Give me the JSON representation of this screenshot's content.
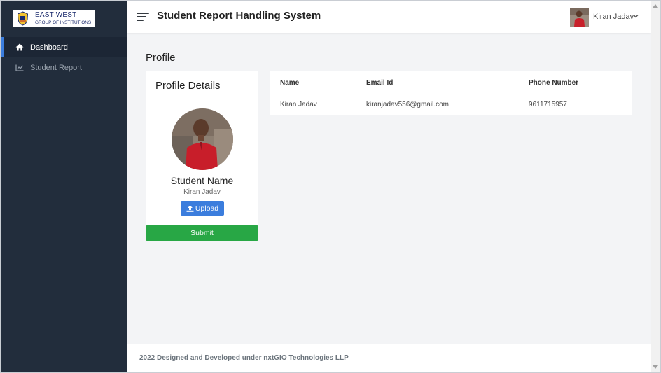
{
  "sidebar": {
    "logo": {
      "line1": "EAST WEST",
      "line2": "GROUP OF INSTITUTIONS"
    },
    "items": [
      {
        "label": "Dashboard",
        "icon": "home-icon",
        "active": true
      },
      {
        "label": "Student Report",
        "icon": "line-chart-icon",
        "active": false
      }
    ]
  },
  "header": {
    "title": "Student Report Handling System",
    "user_name": "Kiran Jadav"
  },
  "main": {
    "heading": "Profile",
    "profile_card": {
      "title": "Profile Details",
      "student_label": "Student Name",
      "student_value": "Kiran Jadav",
      "upload_label": "Upload",
      "submit_label": "Submit"
    },
    "table": {
      "headers": [
        "Name",
        "Email Id",
        "Phone Number"
      ],
      "rows": [
        [
          "Kiran Jadav",
          "kiranjadav556@gmail.com",
          "9611715957"
        ]
      ]
    }
  },
  "footer": {
    "text": "2022 Designed and Developed under nxtGIO Technologies LLP"
  },
  "colors": {
    "sidebar_bg": "#222d3c",
    "accent": "#3b7ddd",
    "success": "#28a745",
    "page_bg": "#f3f4f6"
  }
}
